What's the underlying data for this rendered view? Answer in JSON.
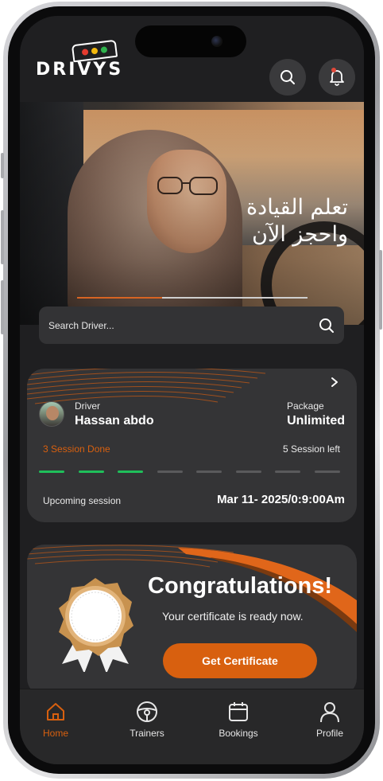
{
  "app": {
    "logo_text": "DRIVYS",
    "arabic_headline_line1": "تعلم القيادة",
    "arabic_headline_line2": "واحجز الآن",
    "hero_slide_progress": 0.37
  },
  "header": {
    "search_icon": "search-icon",
    "notification_icon": "bell-icon",
    "notification_dot_color": "#e0493a"
  },
  "search": {
    "placeholder": "Search Driver..."
  },
  "session_card": {
    "driver_label": "Driver",
    "driver_name": "Hassan abdo",
    "package_label": "Package",
    "package_value": "Unlimited",
    "sessions_done": "3 Session Done",
    "sessions_left": "5 Session left",
    "sessions_total": 8,
    "sessions_completed": 3,
    "upcoming_label": "Upcoming session",
    "upcoming_value": "Mar 11- 2025/0:9:00Am"
  },
  "certificate_card": {
    "title": "Congratulations!",
    "subtitle": "Your certificate is ready now.",
    "button_label": "Get Certificate"
  },
  "bottom_nav": {
    "items": [
      {
        "label": "Home",
        "icon": "home-icon",
        "active": true
      },
      {
        "label": "Trainers",
        "icon": "steering-wheel-icon",
        "active": false
      },
      {
        "label": "Bookings",
        "icon": "calendar-icon",
        "active": false
      },
      {
        "label": "Profile",
        "icon": "user-icon",
        "active": false
      }
    ]
  },
  "colors": {
    "accent": "#d8600f",
    "progress_done": "#1fbf5a",
    "progress_pending": "#5a5a5c",
    "background": "#1f1f21",
    "card": "#343436"
  }
}
